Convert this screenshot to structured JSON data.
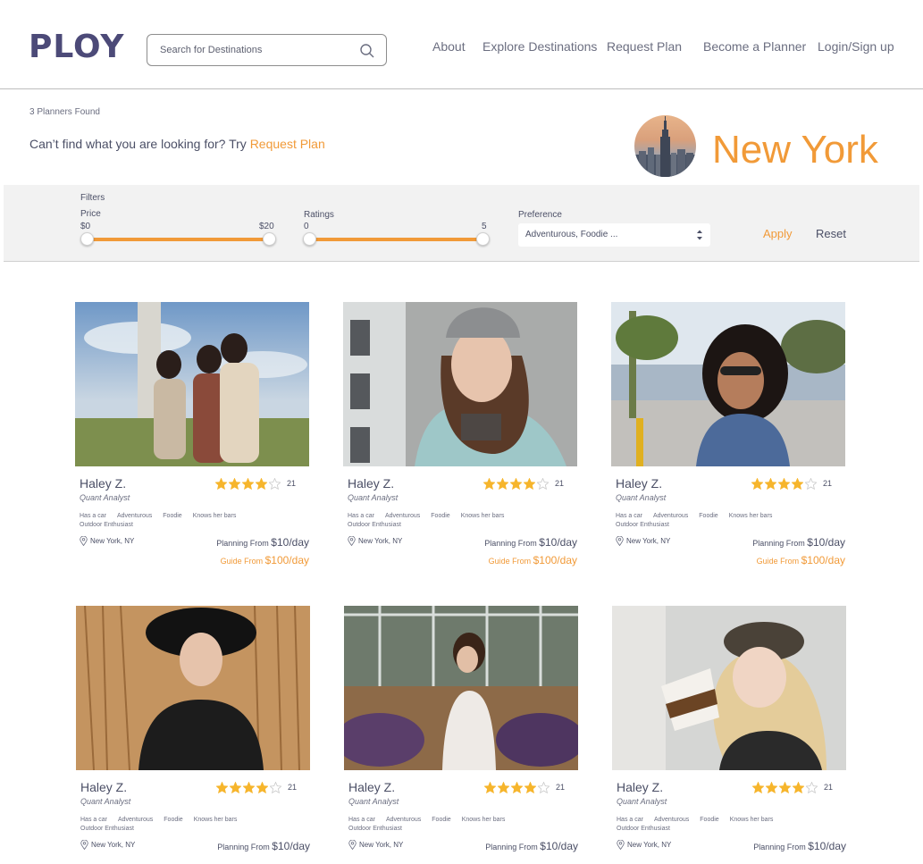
{
  "header": {
    "logo": "PLOY",
    "search_placeholder": "Search for Destinations",
    "nav": [
      "About",
      "Explore Destinations",
      "Request Plan",
      "Become a Planner",
      "Login/Sign up"
    ]
  },
  "results": {
    "count_text": "3 Planners Found",
    "prompt": "Can’t find what you are looking for?  Try ",
    "prompt_link": "Request Plan",
    "city": "New York"
  },
  "filters": {
    "title": "Filters",
    "price": {
      "label": "Price",
      "min": "$0",
      "max": "$20",
      "low": 0,
      "high": 20
    },
    "ratings": {
      "label": "Ratings",
      "min": "0",
      "max": "5",
      "low": 0,
      "high": 5
    },
    "preference": {
      "label": "Preference",
      "value": "Adventurous, Foodie ..."
    },
    "apply": "Apply",
    "reset": "Reset"
  },
  "colors": {
    "accent": "#f19a38",
    "brand": "#4c4a78",
    "text": "#4b4f66"
  },
  "planners": [
    {
      "name": "Haley Z.",
      "role": "Quant Analyst",
      "rating": 4,
      "reviews": "21",
      "tags": [
        "Has a car",
        "Adventurous",
        "Foodie",
        "Knows her bars",
        "Outdoor Enthusiast"
      ],
      "location": "New York, NY",
      "plan_label": "Planning From ",
      "plan_price": "$10/day",
      "guide_label": "Guide From ",
      "guide_price": "$100/day"
    },
    {
      "name": "Haley Z.",
      "role": "Quant Analyst",
      "rating": 4,
      "reviews": "21",
      "tags": [
        "Has a car",
        "Adventurous",
        "Foodie",
        "Knows her bars",
        "Outdoor Enthusiast"
      ],
      "location": "New York, NY",
      "plan_label": "Planning From ",
      "plan_price": "$10/day",
      "guide_label": "Guide From ",
      "guide_price": "$100/day"
    },
    {
      "name": "Haley Z.",
      "role": "Quant Analyst",
      "rating": 4,
      "reviews": "21",
      "tags": [
        "Has a car",
        "Adventurous",
        "Foodie",
        "Knows her bars",
        "Outdoor Enthusiast"
      ],
      "location": "New York, NY",
      "plan_label": "Planning From ",
      "plan_price": "$10/day",
      "guide_label": "Guide From ",
      "guide_price": "$100/day"
    },
    {
      "name": "Haley Z.",
      "role": "Quant Analyst",
      "rating": 4,
      "reviews": "21",
      "tags": [
        "Has a car",
        "Adventurous",
        "Foodie",
        "Knows her bars",
        "Outdoor Enthusiast"
      ],
      "location": "New York, NY",
      "plan_label": "Planning From ",
      "plan_price": "$10/day",
      "guide_label": "",
      "guide_price": ""
    },
    {
      "name": "Haley Z.",
      "role": "Quant Analyst",
      "rating": 4,
      "reviews": "21",
      "tags": [
        "Has a car",
        "Adventurous",
        "Foodie",
        "Knows her bars",
        "Outdoor Enthusiast"
      ],
      "location": "New York, NY",
      "plan_label": "Planning From ",
      "plan_price": "$10/day",
      "guide_label": "",
      "guide_price": ""
    },
    {
      "name": "Haley Z.",
      "role": "Quant Analyst",
      "rating": 4,
      "reviews": "21",
      "tags": [
        "Has a car",
        "Adventurous",
        "Foodie",
        "Knows her bars",
        "Outdoor Enthusiast"
      ],
      "location": "New York, NY",
      "plan_label": "Planning From ",
      "plan_price": "$10/day",
      "guide_label": "",
      "guide_price": ""
    }
  ]
}
